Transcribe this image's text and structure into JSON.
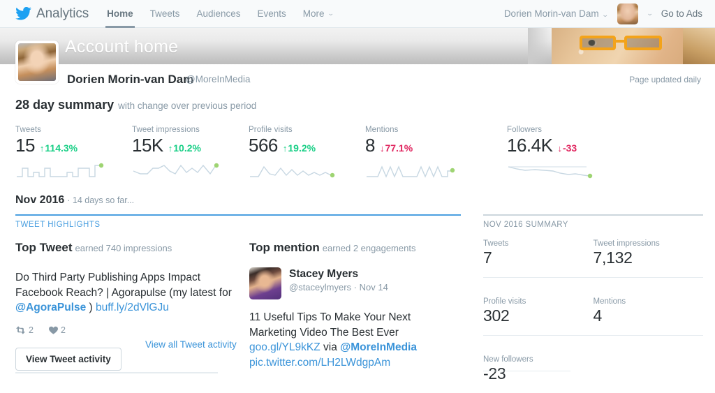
{
  "nav": {
    "brand": "Analytics",
    "items": [
      {
        "label": "Home",
        "active": true
      },
      {
        "label": "Tweets",
        "active": false
      },
      {
        "label": "Audiences",
        "active": false
      },
      {
        "label": "Events",
        "active": false
      },
      {
        "label": "More",
        "active": false,
        "caret": true
      }
    ],
    "account_name": "Dorien Morin-van Dam",
    "go_to_ads": "Go to Ads",
    "caret": "⌄"
  },
  "header": {
    "title": "Account home",
    "profile_name": "Dorien Morin-van Dam",
    "profile_handle": "@MoreInMedia",
    "page_updated": "Page updated daily"
  },
  "summary": {
    "title": "28 day summary",
    "subtitle": "with change over previous period",
    "metrics": [
      {
        "label": "Tweets",
        "value": "15",
        "delta": "114.3%",
        "direction": "up",
        "arrow": "↑"
      },
      {
        "label": "Tweet impressions",
        "value": "15K",
        "delta": "10.2%",
        "direction": "up",
        "arrow": "↑"
      },
      {
        "label": "Profile visits",
        "value": "566",
        "delta": "19.2%",
        "direction": "up",
        "arrow": "↑"
      },
      {
        "label": "Mentions",
        "value": "8",
        "delta": "77.1%",
        "direction": "down",
        "arrow": "↓"
      },
      {
        "label": "Followers",
        "value": "16.4K",
        "delta": "-33",
        "direction": "down",
        "arrow": "↓"
      }
    ]
  },
  "month": {
    "title": "Nov 2016",
    "subtitle": "· 14 days so far...",
    "highlights_label": "TWEET HIGHLIGHTS"
  },
  "top_tweet": {
    "heading": "Top Tweet",
    "subheading": "earned 740 impressions",
    "text_part1": "Do Third Party Publishing Apps Impact Facebook Reach? | Agorapulse (my latest for ",
    "mention": "@AgoraPulse",
    "text_part2": " ) ",
    "link": "buff.ly/2dVlGJu",
    "retweets": "2",
    "likes": "2",
    "button_label": "View Tweet activity",
    "view_all_label": "View all Tweet activity"
  },
  "top_mention": {
    "heading": "Top mention",
    "subheading": "earned 2 engagements",
    "user_name": "Stacey Myers",
    "user_handle": "@staceylmyers",
    "date": "Nov 14",
    "text": "11 Useful Tips To Make Your Next Marketing Video The Best Ever ",
    "link1": "goo.gl/YL9kKZ",
    "via": " via ",
    "mention": "@MoreInMedia",
    "link2": "pic.twitter.com/LH2LWdgpAm"
  },
  "month_summary": {
    "label": "NOV 2016 SUMMARY",
    "cells": [
      {
        "label": "Tweets",
        "value": "7"
      },
      {
        "label": "Tweet impressions",
        "value": "7,132"
      },
      {
        "label": "Profile visits",
        "value": "302"
      },
      {
        "label": "Mentions",
        "value": "4"
      },
      {
        "label": "New followers",
        "value": "-23"
      },
      {
        "label": "",
        "value": ""
      }
    ]
  },
  "colors": {
    "twitter_blue": "#1da1f2",
    "link_blue": "#3b94d9",
    "accent_blue": "#4a9fe0",
    "up_green": "#19cf86",
    "down_red": "#e0245e",
    "sparkline": "#c7d7e2",
    "spark_dot": "#9ed472",
    "text_dark": "#292f33",
    "text_muted": "#8899a6"
  },
  "chart_data": [
    {
      "type": "line",
      "title": "Tweets sparkline",
      "values": [
        2,
        0,
        2,
        0,
        1,
        0,
        3,
        0,
        1,
        0,
        0,
        2,
        0,
        3,
        3
      ],
      "endpoint_marker": true
    },
    {
      "type": "line",
      "title": "Tweet impressions sparkline",
      "values": [
        3,
        2,
        2,
        4,
        3,
        5,
        3,
        2,
        5,
        3,
        4,
        3,
        5,
        2,
        5
      ],
      "endpoint_marker": true
    },
    {
      "type": "line",
      "title": "Profile visits sparkline",
      "values": [
        1,
        1,
        4,
        2,
        3,
        2,
        4,
        2,
        3,
        2,
        3,
        2,
        3,
        2,
        2
      ],
      "endpoint_marker": true
    },
    {
      "type": "line",
      "title": "Mentions sparkline",
      "values": [
        0,
        0,
        3,
        1,
        3,
        1,
        0,
        0,
        0,
        3,
        1,
        3,
        0,
        0,
        3
      ],
      "endpoint_marker": true
    },
    {
      "type": "line",
      "title": "Followers sparkline",
      "values": [
        5,
        5,
        4,
        4,
        4,
        4,
        3,
        3,
        3,
        2,
        2,
        1,
        1,
        1,
        1
      ],
      "endpoint_marker": true
    }
  ]
}
